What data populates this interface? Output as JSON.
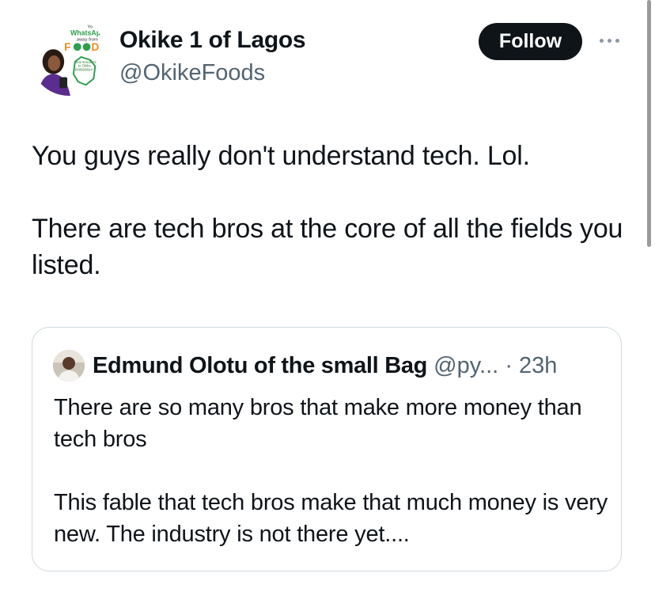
{
  "author": {
    "display_name": "Okike 1 of Lagos",
    "handle": "@OkikeFoods",
    "avatar_text": {
      "line1": "Yo",
      "line2": "WhatsAp",
      "line3": "away from",
      "logo_f": "F",
      "logo_d": "D",
      "small1": "Just sende Hi",
      "small2": "to Okike",
      "small3": "09080882​4"
    }
  },
  "actions": {
    "follow_label": "Follow"
  },
  "tweet": {
    "paragraphs": [
      "You guys really don't understand tech. Lol.",
      "There are tech bros at the core of all the fields you listed."
    ]
  },
  "quoted": {
    "author_name": "Edmund Olotu of the small Bag",
    "handle": "@py...",
    "time": "· 23h",
    "paragraphs": [
      "There are so many bros that make more money than tech bros",
      "This fable that tech bros make that much money is very new. The industry is not there yet...."
    ]
  },
  "colors": {
    "text": "#0f1419",
    "secondary": "#536471",
    "border": "#cfd9de",
    "follow_bg": "#0f1419",
    "brand_green": "#2e9e4f",
    "brand_orange": "#f08a1c"
  }
}
